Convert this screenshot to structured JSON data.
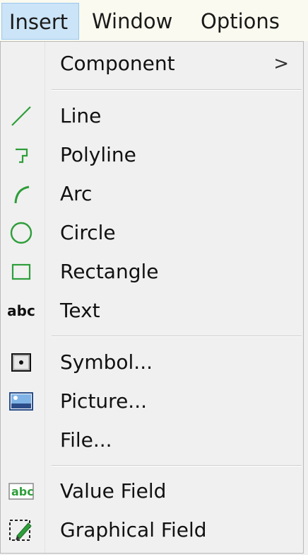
{
  "menubar": {
    "items": [
      {
        "label": "Insert"
      },
      {
        "label": "Window"
      },
      {
        "label": "Options"
      }
    ]
  },
  "menu": {
    "component": {
      "label": "Component",
      "submenu_arrow": ">"
    },
    "line": {
      "label": "Line",
      "icon": "line-icon"
    },
    "polyline": {
      "label": "Polyline",
      "icon": "polyline-icon"
    },
    "arc": {
      "label": "Arc",
      "icon": "arc-icon"
    },
    "circle": {
      "label": "Circle",
      "icon": "circle-icon"
    },
    "rectangle": {
      "label": "Rectangle",
      "icon": "rectangle-icon"
    },
    "text": {
      "label": "Text",
      "icon": "text-icon",
      "icon_text": "abc"
    },
    "symbol": {
      "label": "Symbol...",
      "icon": "symbol-icon"
    },
    "picture": {
      "label": "Picture...",
      "icon": "picture-icon"
    },
    "file": {
      "label": "File..."
    },
    "value_field": {
      "label": "Value Field",
      "icon": "value-field-icon",
      "icon_text": "abc"
    },
    "graphical_field": {
      "label": "Graphical Field",
      "icon": "graphical-field-icon"
    }
  },
  "colors": {
    "shape_green": "#2e9e3a",
    "menu_bg": "#f0f0f0",
    "menubar_bg": "#fafaf0",
    "active_highlight": "#cce4f7"
  }
}
